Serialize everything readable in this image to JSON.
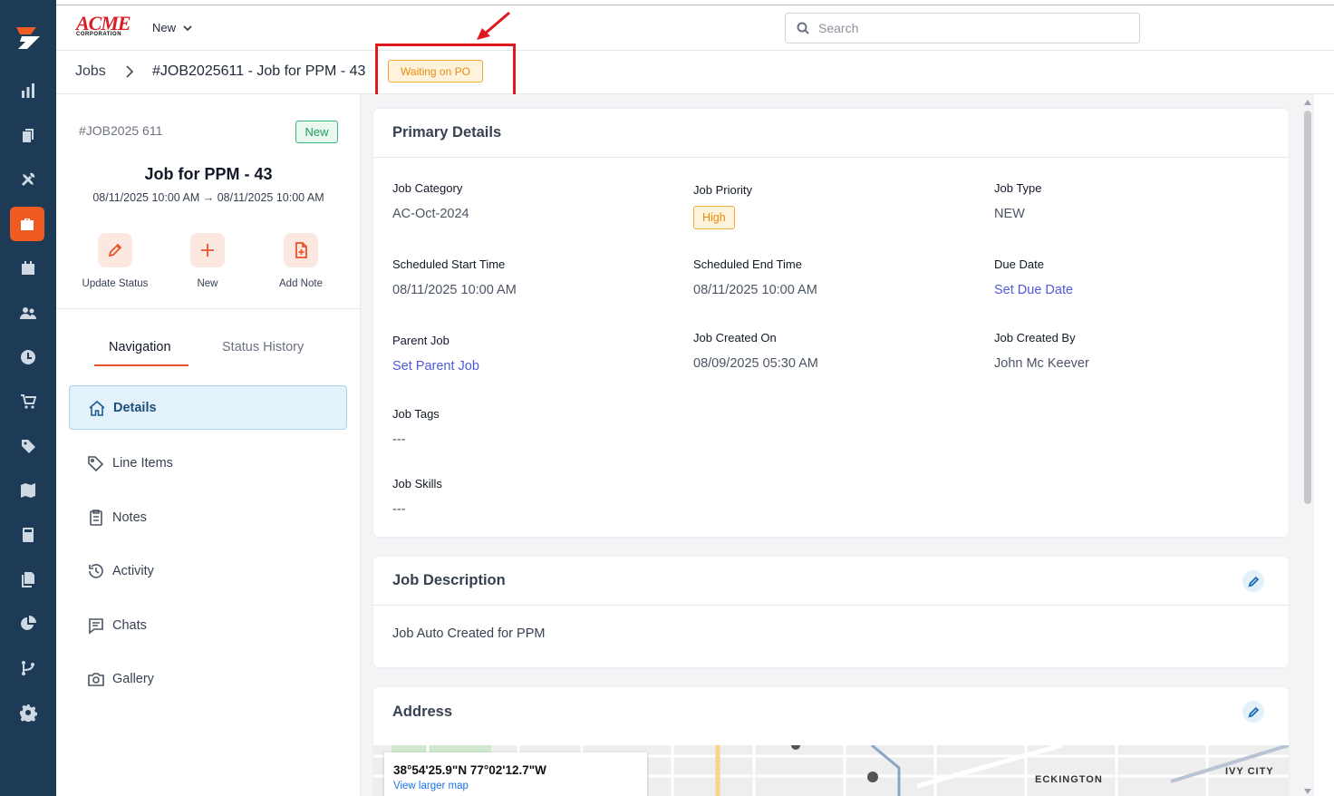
{
  "topbar": {
    "brand_main": "ACME",
    "brand_sub": "CORPORATION",
    "new_label": "New",
    "search_placeholder": "Search"
  },
  "breadcrumb": {
    "root": "Jobs",
    "title": "#JOB2025611 - Job for PPM - 43",
    "status": "Waiting on PO"
  },
  "job": {
    "id": "#JOB2025 611",
    "badge": "New",
    "name": "Job for PPM - 43",
    "dates": "08/11/2025 10:00 AM → 08/11/2025 10:00 AM"
  },
  "actions": [
    {
      "label": "Update Status",
      "icon": "pencil-icon"
    },
    {
      "label": "New",
      "icon": "plus-icon"
    },
    {
      "label": "Add Note",
      "icon": "add-note-icon"
    }
  ],
  "tabs": {
    "navigation": "Navigation",
    "status_history": "Status History"
  },
  "nav": [
    {
      "label": "Details",
      "icon": "home-icon",
      "active": true
    },
    {
      "label": "Line Items",
      "icon": "tag-icon"
    },
    {
      "label": "Notes",
      "icon": "clipboard-icon"
    },
    {
      "label": "Activity",
      "icon": "history-icon"
    },
    {
      "label": "Chats",
      "icon": "chat-icon"
    },
    {
      "label": "Gallery",
      "icon": "camera-icon"
    }
  ],
  "primary": {
    "title": "Primary Details",
    "job_category_label": "Job Category",
    "job_category": "AC-Oct-2024",
    "job_priority_label": "Job Priority",
    "job_priority": "High",
    "job_type_label": "Job Type",
    "job_type": "NEW",
    "start_label": "Scheduled Start Time",
    "start": "08/11/2025 10:00 AM",
    "end_label": "Scheduled End Time",
    "end": "08/11/2025 10:00 AM",
    "due_label": "Due Date",
    "due": "Set Due Date",
    "parent_label": "Parent Job",
    "parent": "Set Parent Job",
    "created_on_label": "Job Created On",
    "created_on": "08/09/2025 05:30 AM",
    "created_by_label": "Job Created By",
    "created_by": "John Mc Keever",
    "tags_label": "Job Tags",
    "tags": "---",
    "skills_label": "Job Skills",
    "skills": "---"
  },
  "description": {
    "title": "Job Description",
    "text": "Job Auto Created for PPM"
  },
  "address": {
    "title": "Address",
    "coord": "38°54'25.9\"N 77°02'12.7\"W",
    "larger_map": "View larger map",
    "label_eckington": "ECKINGTON",
    "label_ivy": "IVY CITY"
  },
  "colors": {
    "accent": "#e8542a",
    "rail": "#1d3a56",
    "link": "#4f5bd5",
    "warning": "#e88a0f"
  }
}
